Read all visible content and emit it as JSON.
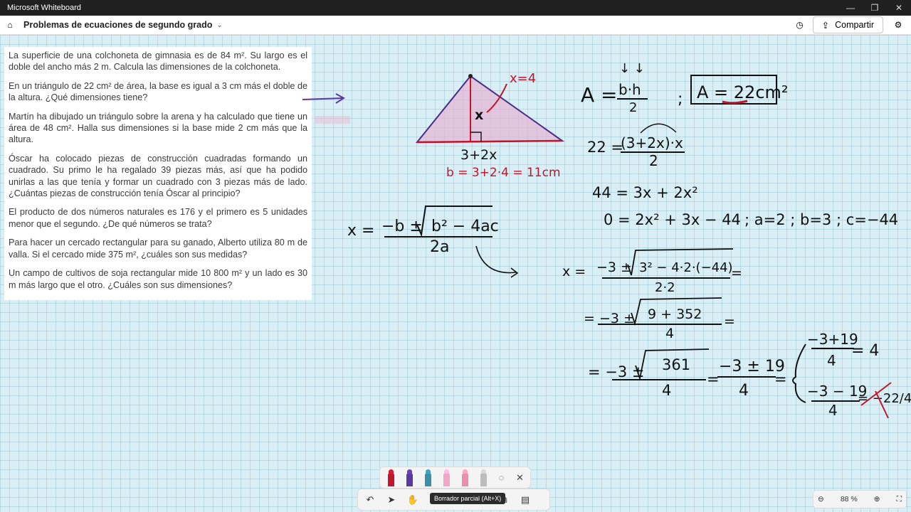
{
  "window": {
    "title": "Microsoft Whiteboard",
    "minimize": "—",
    "maximize": "❐",
    "close": "✕"
  },
  "appbar": {
    "home_icon": "⌂",
    "board_name": "Problemas de ecuaciones de segundo grado",
    "chevron": "⌄",
    "timer_icon": "◷",
    "share_icon": "⇪",
    "share_label": "Compartir",
    "settings_icon": "⚙"
  },
  "problems": [
    "La superficie de una colchoneta de gimnasia es de 84 m². Su largo es el doble del ancho más 2 m. Calcula las dimensiones de la colchoneta.",
    "En un triángulo de 22 cm² de área, la base es igual a 3 cm más el doble de la altura. ¿Qué dimensiones tiene?",
    "Martín ha dibujado un triángulo sobre la arena y ha calculado que tiene un área de 48 cm². Halla sus dimensiones si la base mide 2 cm más que la altura.",
    "Óscar ha colocado piezas de construcción cuadradas formando un cuadrado. Su primo le ha regalado 39 piezas más, así que ha podido unirlas a las que tenía y formar un cuadrado con 3 piezas más de lado. ¿Cuántas piezas de construcción tenía Óscar al principio?",
    "El producto de dos números naturales es 176 y el primero es 5 unidades menor que el segundo. ¿De qué números se trata?",
    "Para hacer un cercado rectangular para su ganado, Alberto utiliza 80 m de valla. Si el cercado mide 375 m², ¿cuáles son sus medidas?",
    "Un campo de cultivos de soja rectangular mide 10 800 m² y un lado es 30 m más largo que el otro. ¿Cuáles son sus dimensiones?"
  ],
  "ink": {
    "x_eq": "x=4",
    "x_var": "x",
    "base_expr": "3+2x",
    "b_value": "b = 3+2·4 = 11cm",
    "area_formula_a": "A =",
    "area_formula_num": "b·h",
    "area_formula_den": "2",
    "semicolon": ";",
    "area_given": "A = 22cm²",
    "eq1_left": "22 =",
    "eq1_num": "(3+2x)·x",
    "eq1_den": "2",
    "eq2": "44 = 3x + 2x²",
    "eq3": "0 = 2x² + 3x − 44",
    "coeffs": "; a=2 ; b=3 ; c=−44",
    "quad_x": "x =",
    "quad_num_a": "−b ±",
    "quad_rad": "b² − 4ac",
    "quad_den": "2a",
    "sub1_x": "x =",
    "sub1_num_a": "−3 ±",
    "sub1_rad": "3² − 4·2·(−44)",
    "sub1_den": "2·2",
    "equals": "=",
    "sub2_num_a": "= −3 ±",
    "sub2_rad": "9 + 352",
    "sub2_den": "4",
    "sub3_num_a": "= −3 ±",
    "sub3_rad": "361",
    "sub3_den": "4",
    "sub4_num": "−3 ± 19",
    "sub4_den": "4",
    "sol1_num": "−3+19",
    "sol1_den": "4",
    "sol1_val": "= 4",
    "sol2_num": "−3 − 19",
    "sol2_den": "4",
    "sol2_val": "= −22/4"
  },
  "pens": [
    {
      "name": "red-pen",
      "color": "#c0152a"
    },
    {
      "name": "purple-pen",
      "color": "#5a3aa0"
    },
    {
      "name": "teal-pen",
      "color": "#3d8fa8"
    },
    {
      "name": "pink-highlighter",
      "color": "#f0a6c6"
    },
    {
      "name": "eraser",
      "color": "#e88fae"
    },
    {
      "name": "ruler",
      "color": "#bdbdbd"
    }
  ],
  "toolbar": {
    "lasso_icon": "◌",
    "close_icon": "✕",
    "undo_icon": "↶",
    "select_icon": "➤",
    "hand_icon": "✋",
    "pen_icon": "✎",
    "shapes_icon": "⧉",
    "more_icon": "▤",
    "tooltip": "Borrador parcial (Alt+X)"
  },
  "zoom": {
    "zoom_out": "⊖",
    "level": "88 %",
    "zoom_in": "⊕",
    "fit": "⛶"
  }
}
